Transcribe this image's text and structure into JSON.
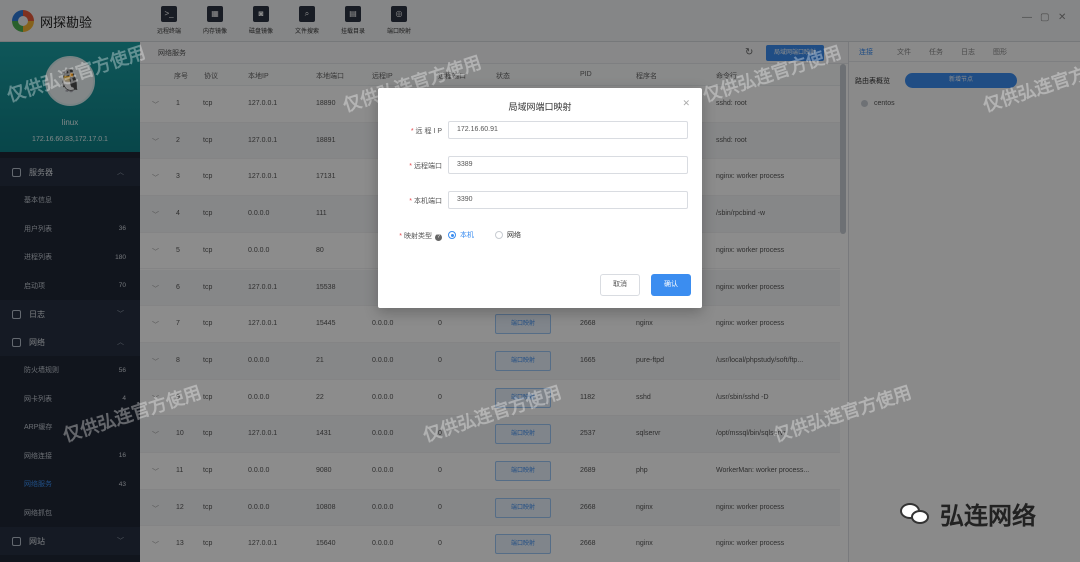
{
  "app": {
    "title": "网探勘验"
  },
  "toolbar": [
    {
      "label": "远程终端",
      "icon": "terminal-icon",
      "glyph": ">_"
    },
    {
      "label": "内存镜像",
      "icon": "memory-icon",
      "glyph": "▦"
    },
    {
      "label": "磁盘镜像",
      "icon": "disk-icon",
      "glyph": "◙"
    },
    {
      "label": "文件搜索",
      "icon": "file-search-icon",
      "glyph": "⌕"
    },
    {
      "label": "挂载目录",
      "icon": "folder-icon",
      "glyph": "▤"
    },
    {
      "label": "端口映射",
      "icon": "port-map-icon",
      "glyph": "◎"
    }
  ],
  "profile": {
    "name": "linux",
    "ip": "172.16.60.83,172.17.0.1"
  },
  "nav": {
    "server": "服务器",
    "server_items": [
      {
        "label": "基本信息",
        "count": ""
      },
      {
        "label": "用户列表",
        "count": "36"
      },
      {
        "label": "进程列表",
        "count": "180"
      },
      {
        "label": "启动项",
        "count": "70"
      }
    ],
    "log": "日志",
    "network": "网络",
    "network_items": [
      {
        "label": "防火墙规则",
        "count": "56"
      },
      {
        "label": "网卡列表",
        "count": "4"
      },
      {
        "label": "ARP缓存",
        "count": ""
      },
      {
        "label": "网络连接",
        "count": "16"
      },
      {
        "label": "网络服务",
        "count": "43"
      },
      {
        "label": "网络抓包",
        "count": ""
      }
    ],
    "website": "网站"
  },
  "main": {
    "title": "网络服务",
    "header_btn": "局域网端口映射",
    "columns": [
      "序号",
      "协议",
      "本地IP",
      "本地端口",
      "远程IP",
      "远程端口",
      "状态",
      "PID",
      "程序名",
      "命令行"
    ],
    "map_btn": "端口映射",
    "rows": [
      {
        "no": "1",
        "proto": "tcp",
        "lip": "127.0.0.1",
        "lport": "18890",
        "rip": "",
        "rport": "",
        "pid": "",
        "prog": "",
        "cmd": "sshd: root"
      },
      {
        "no": "2",
        "proto": "tcp",
        "lip": "127.0.0.1",
        "lport": "18891",
        "rip": "",
        "rport": "",
        "pid": "",
        "prog": "",
        "cmd": "sshd: root"
      },
      {
        "no": "3",
        "proto": "tcp",
        "lip": "127.0.0.1",
        "lport": "17131",
        "rip": "",
        "rport": "",
        "pid": "",
        "prog": "",
        "cmd": "nginx: worker process"
      },
      {
        "no": "4",
        "proto": "tcp",
        "lip": "0.0.0.0",
        "lport": "111",
        "rip": "",
        "rport": "",
        "pid": "",
        "prog": "",
        "cmd": "/sbin/rpcbind -w"
      },
      {
        "no": "5",
        "proto": "tcp",
        "lip": "0.0.0.0",
        "lport": "80",
        "rip": "",
        "rport": "",
        "pid": "",
        "prog": "",
        "cmd": "nginx: worker process"
      },
      {
        "no": "6",
        "proto": "tcp",
        "lip": "127.0.0.1",
        "lport": "15538",
        "rip": "",
        "rport": "",
        "pid": "",
        "prog": "",
        "cmd": "nginx: worker process"
      },
      {
        "no": "7",
        "proto": "tcp",
        "lip": "127.0.0.1",
        "lport": "15445",
        "rip": "0.0.0.0",
        "rport": "0",
        "pid": "2668",
        "prog": "nginx",
        "cmd": "nginx: worker process"
      },
      {
        "no": "8",
        "proto": "tcp",
        "lip": "0.0.0.0",
        "lport": "21",
        "rip": "0.0.0.0",
        "rport": "0",
        "pid": "1665",
        "prog": "pure-ftpd",
        "cmd": "/usr/local/phpstudy/soft/ftp..."
      },
      {
        "no": "9",
        "proto": "tcp",
        "lip": "0.0.0.0",
        "lport": "22",
        "rip": "0.0.0.0",
        "rport": "0",
        "pid": "1182",
        "prog": "sshd",
        "cmd": "/usr/sbin/sshd -D"
      },
      {
        "no": "10",
        "proto": "tcp",
        "lip": "127.0.0.1",
        "lport": "1431",
        "rip": "0.0.0.0",
        "rport": "0",
        "pid": "2537",
        "prog": "sqlservr",
        "cmd": "/opt/mssql/bin/sqlservr"
      },
      {
        "no": "11",
        "proto": "tcp",
        "lip": "0.0.0.0",
        "lport": "9080",
        "rip": "0.0.0.0",
        "rport": "0",
        "pid": "2689",
        "prog": "php",
        "cmd": "WorkerMan: worker process..."
      },
      {
        "no": "12",
        "proto": "tcp",
        "lip": "0.0.0.0",
        "lport": "10808",
        "rip": "0.0.0.0",
        "rport": "0",
        "pid": "2668",
        "prog": "nginx",
        "cmd": "nginx: worker process"
      },
      {
        "no": "13",
        "proto": "tcp",
        "lip": "127.0.0.1",
        "lport": "15640",
        "rip": "0.0.0.0",
        "rport": "0",
        "pid": "2668",
        "prog": "nginx",
        "cmd": "nginx: worker process"
      }
    ]
  },
  "right": {
    "tabs": [
      "连接",
      "文件",
      "任务",
      "日志",
      "图形"
    ],
    "section": "路由表概览",
    "add_btn": "新增节点",
    "item": "centos"
  },
  "modal": {
    "title": "局域网端口映射",
    "remote_ip_label": "远 程 I P",
    "remote_ip": "172.16.60.91",
    "remote_port_label": "远程端口",
    "remote_port": "3389",
    "local_port_label": "本机端口",
    "local_port": "3390",
    "type_label": "映射类型",
    "type_local": "本机",
    "type_network": "网络",
    "cancel": "取消",
    "ok": "确认"
  },
  "watermark": "仅供弘连官方使用",
  "brand_footer": "弘连网络",
  "colors": {
    "accent": "#3b8df0",
    "sidebar": "#1f2735",
    "profile": "#1b9fa3"
  }
}
